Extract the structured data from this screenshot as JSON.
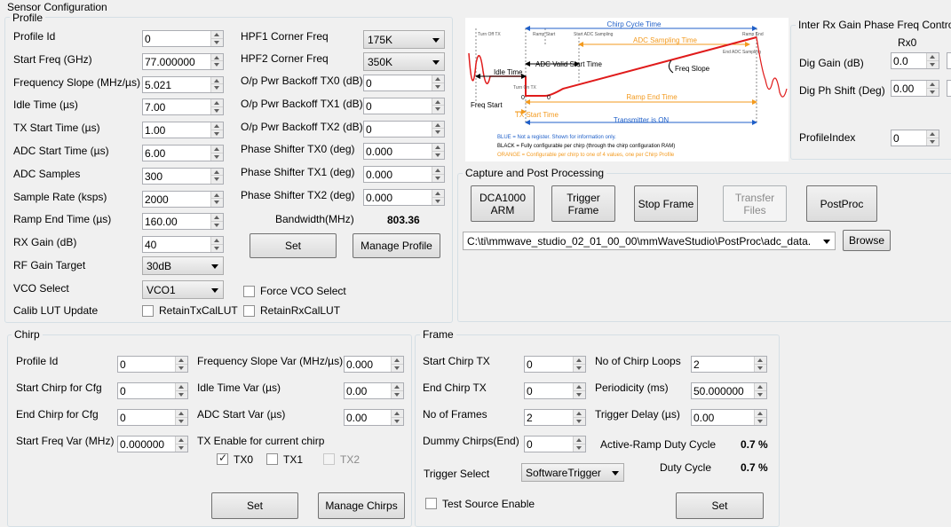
{
  "window": {
    "title": "Sensor Configuration"
  },
  "profile": {
    "title": "Profile",
    "left_fields": [
      {
        "label": "Profile Id",
        "value": "0"
      },
      {
        "label": "Start Freq (GHz)",
        "value": "77.000000"
      },
      {
        "label": "Frequency Slope (MHz/µs)",
        "value": "5.021"
      },
      {
        "label": "Idle Time (µs)",
        "value": "7.00"
      },
      {
        "label": "TX Start Time (µs)",
        "value": "1.00"
      },
      {
        "label": "ADC Start Time (µs)",
        "value": "6.00"
      },
      {
        "label": "ADC Samples",
        "value": "300"
      },
      {
        "label": "Sample Rate (ksps)",
        "value": "2000"
      },
      {
        "label": "Ramp End Time (µs)",
        "value": "160.00"
      },
      {
        "label": "RX Gain (dB)",
        "value": "40"
      }
    ],
    "rf_gain_target": {
      "label": "RF Gain Target",
      "value": "30dB"
    },
    "vco_select": {
      "label": "VCO Select",
      "value": "VCO1"
    },
    "calib_lut_update": {
      "label": "Calib LUT Update"
    },
    "retain_tx": {
      "label": "RetainTxCalLUT",
      "checked": false
    },
    "retain_rx": {
      "label": "RetainRxCalLUT",
      "checked": false
    },
    "force_vco": {
      "label": "Force VCO Select",
      "checked": false
    },
    "hpf1": {
      "label": "HPF1 Corner Freq",
      "value": "175K"
    },
    "hpf2": {
      "label": "HPF2 Corner Freq",
      "value": "350K"
    },
    "right_fields": [
      {
        "label": "O/p Pwr Backoff TX0 (dB)",
        "value": "0"
      },
      {
        "label": "O/p Pwr Backoff TX1 (dB)",
        "value": "0"
      },
      {
        "label": "O/p Pwr Backoff TX2 (dB)",
        "value": "0"
      },
      {
        "label": "Phase Shifter TX0 (deg)",
        "value": "0.000"
      },
      {
        "label": "Phase Shifter TX1 (deg)",
        "value": "0.000"
      },
      {
        "label": "Phase Shifter TX2 (deg)",
        "value": "0.000"
      }
    ],
    "bandwidth": {
      "label": "Bandwidth(MHz)",
      "value": "803.36"
    },
    "set_label": "Set",
    "manage_label": "Manage Profile"
  },
  "diagram": {
    "chirp_cycle_time": "Chirp Cycle Time",
    "turn_off_tx": "Turn Off TX",
    "ramp_start": "Ramp Start",
    "start_adc_sampling": "Start ADC Sampling",
    "adc_sampling_time": "ADC Sampling Time",
    "ramp_end": "Ramp End",
    "end_adc_sampling": "End ADC Sampling",
    "adc_valid_start_time": "ADC Valid Start Time",
    "idle_time": "Idle Time",
    "freq_slope": "Freq Slope",
    "turn_on_tx": "Turn On TX",
    "zero_a": "0",
    "zero_b": "0",
    "ramp_end_time": "Ramp End Time",
    "freq_start": "Freq Start",
    "tx_start_time": "TX Start Time",
    "transmitter_on": "Transmitter is ON",
    "legend_blue": "BLUE = Not a register. Shown for information only.",
    "legend_black": "BLACK = Fully configurable per chirp (through the chirp configuration RAM)",
    "legend_orange": "ORANGE = Configurable per chirp to one of 4 values, one per Chirp Profile",
    "colors": {
      "blue": "#1f5fc8",
      "orange": "#f39a1e",
      "red": "#e01b1b"
    }
  },
  "inter_rx": {
    "title": "Inter Rx Gain Phase Freq Contro",
    "rx0": "Rx0",
    "dig_gain": {
      "label": "Dig Gain (dB)",
      "value": "0.0"
    },
    "dig_phase": {
      "label": "Dig Ph Shift (Deg)",
      "value": "0.00"
    },
    "profile_index": {
      "label": "ProfileIndex",
      "value": "0"
    }
  },
  "capture": {
    "title": "Capture and Post Processing",
    "buttons": [
      {
        "label": "DCA1000\nARM",
        "enabled": true
      },
      {
        "label": "Trigger\nFrame",
        "enabled": true
      },
      {
        "label": "Stop Frame",
        "enabled": true
      },
      {
        "label": "Transfer\nFiles",
        "enabled": false
      },
      {
        "label": "PostProc",
        "enabled": true
      }
    ],
    "path": "C:\\ti\\mmwave_studio_02_01_00_00\\mmWaveStudio\\PostProc\\adc_data.",
    "browse_label": "Browse"
  },
  "chirp": {
    "title": "Chirp",
    "left_fields": [
      {
        "label": "Profile Id",
        "value": "0"
      },
      {
        "label": "Start Chirp for Cfg",
        "value": "0"
      },
      {
        "label": "End Chirp for Cfg",
        "value": "0"
      },
      {
        "label": "Start Freq Var (MHz)",
        "value": "0.000000"
      }
    ],
    "right_fields": [
      {
        "label": "Frequency Slope Var (MHz/µs)",
        "value": "0.000"
      },
      {
        "label": "Idle Time Var (µs)",
        "value": "0.00"
      },
      {
        "label": "ADC Start Var (µs)",
        "value": "0.00"
      }
    ],
    "tx_enable_label": "TX Enable for current chirp",
    "tx": [
      {
        "label": "TX0",
        "checked": true,
        "enabled": true
      },
      {
        "label": "TX1",
        "checked": false,
        "enabled": true
      },
      {
        "label": "TX2",
        "checked": false,
        "enabled": false
      }
    ],
    "set_label": "Set",
    "manage_label": "Manage Chirps"
  },
  "frame": {
    "title": "Frame",
    "left_fields": [
      {
        "label": "Start Chirp TX",
        "value": "0"
      },
      {
        "label": "End Chirp TX",
        "value": "0"
      },
      {
        "label": "No of Frames",
        "value": "2"
      },
      {
        "label": "Dummy Chirps(End)",
        "value": "0"
      }
    ],
    "right_fields": [
      {
        "label": "No of Chirp Loops",
        "value": "2"
      },
      {
        "label": "Periodicity (ms)",
        "value": "50.000000"
      },
      {
        "label": "Trigger Delay (µs)",
        "value": "0.00"
      }
    ],
    "active_ramp": {
      "label": "Active-Ramp Duty Cycle",
      "value": "0.7 %"
    },
    "duty_cycle": {
      "label": "Duty Cycle",
      "value": "0.7 %"
    },
    "trigger_select": {
      "label": "Trigger Select",
      "value": "SoftwareTrigger"
    },
    "test_source": {
      "label": "Test Source Enable",
      "checked": false
    },
    "set_label": "Set"
  }
}
